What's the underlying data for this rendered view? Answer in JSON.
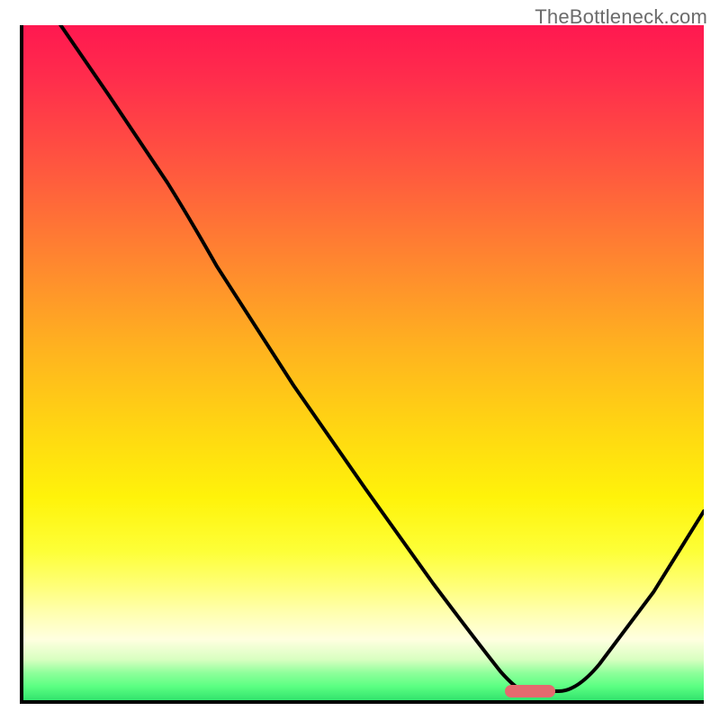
{
  "watermark": "TheBottleneck.com",
  "marker": {
    "x_frac": 0.745,
    "y_frac": 0.985
  },
  "chart_data": {
    "type": "line",
    "title": "",
    "xlabel": "",
    "ylabel": "",
    "xlim": [
      0,
      1
    ],
    "ylim": [
      0,
      1
    ],
    "background": "bottleneck-gradient",
    "series": [
      {
        "name": "bottleneck-curve",
        "x": [
          0.05,
          0.12,
          0.22,
          0.3,
          0.4,
          0.5,
          0.6,
          0.68,
          0.73,
          0.78,
          0.83,
          0.9,
          1.0
        ],
        "y": [
          1.0,
          0.9,
          0.76,
          0.65,
          0.5,
          0.35,
          0.2,
          0.08,
          0.01,
          0.01,
          0.04,
          0.14,
          0.29
        ]
      }
    ],
    "marker_point": {
      "x": 0.745,
      "y": 0.015
    }
  }
}
